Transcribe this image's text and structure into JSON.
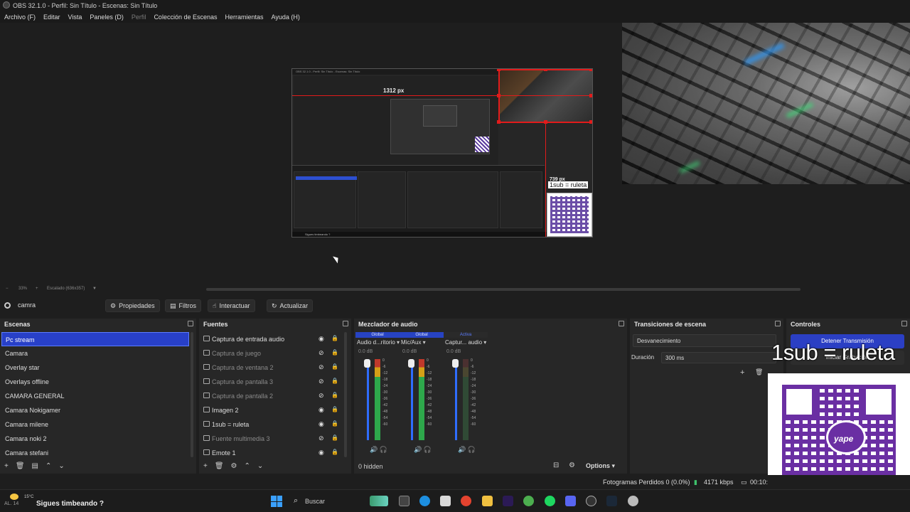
{
  "window": {
    "title": "OBS 32.1.0 - Perfil: Sin Título - Escenas: Sin Título"
  },
  "menu": [
    {
      "label": "Archivo (F)",
      "dim": false
    },
    {
      "label": "Editar",
      "dim": false
    },
    {
      "label": "Vista",
      "dim": false
    },
    {
      "label": "Paneles (D)",
      "dim": false
    },
    {
      "label": "Perfil",
      "dim": true
    },
    {
      "label": "Colección de Escenas",
      "dim": false
    },
    {
      "label": "Herramientas",
      "dim": false
    },
    {
      "label": "Ayuda (H)",
      "dim": false
    }
  ],
  "preview": {
    "px_label_top": "1312 px",
    "px_label_right": "739 px",
    "sub_label": "1sub = ruleta"
  },
  "zoom": {
    "value": "33%",
    "plus": "+",
    "minus": "−",
    "scene_size": "Escalado (636x357)"
  },
  "context": {
    "source_name": "camra",
    "properties": "Propiedades",
    "filters": "Filtros",
    "interact": "Interactuar",
    "refresh": "Actualizar"
  },
  "scenes": {
    "title": "Escenas",
    "items": [
      "Pc stream",
      "Camara",
      "Overlay star",
      "Overlays offline",
      "CAMARA GENERAL",
      "Camara Nokigamer",
      "Camara milene",
      "Camara noki 2",
      "Camara stefani"
    ],
    "active_index": 0
  },
  "sources": {
    "title": "Fuentes",
    "items": [
      {
        "label": "Captura de entrada audio",
        "visible": true,
        "icon": "microphone-icon"
      },
      {
        "label": "Captura de juego",
        "visible": false,
        "icon": "gamepad-icon"
      },
      {
        "label": "Captura de ventana 2",
        "visible": false,
        "icon": "window-icon"
      },
      {
        "label": "Captura de pantalla 3",
        "visible": false,
        "icon": "monitor-icon"
      },
      {
        "label": "Captura de pantalla 2",
        "visible": false,
        "icon": "monitor-icon"
      },
      {
        "label": "Imagen 2",
        "visible": true,
        "icon": "image-icon"
      },
      {
        "label": "1sub = ruleta",
        "visible": true,
        "icon": "text-icon"
      },
      {
        "label": "Fuente multimedia 3",
        "visible": false,
        "icon": "play-icon"
      },
      {
        "label": "Emote 1",
        "visible": true,
        "icon": "globe-icon"
      }
    ]
  },
  "mixer": {
    "title": "Mezclador de audio",
    "channels": [
      {
        "badge": "Global",
        "name": "Audio d...ritorio",
        "db": "0.0 dB",
        "muted": false,
        "active_badge": false
      },
      {
        "badge": "Global",
        "name": "Mic/Aux",
        "db": "0.0 dB",
        "muted": false,
        "active_badge": false
      },
      {
        "badge": "Activa",
        "name": "Captur... audio",
        "db": "0.0 dB",
        "muted": true,
        "active_badge": true
      }
    ],
    "scale": [
      "0",
      "-6",
      "-12",
      "-18",
      "-24",
      "-30",
      "-36",
      "-42",
      "-48",
      "-54",
      "-60"
    ],
    "hidden": "0 hidden",
    "options": "Options"
  },
  "transitions": {
    "title": "Transiciones de escena",
    "selected": "Desvanecimiento",
    "duration_label": "Duración",
    "duration_value": "300 ms"
  },
  "controls": {
    "title": "Controles",
    "stream_button": "Detener Transmisión",
    "record_button": "Iniciar Grabación"
  },
  "overlay": {
    "sub_text": "1sub = ruleta",
    "qr_logo": "yape"
  },
  "status": {
    "dropped": "Fotogramas Perdidos 0 (0.0%)",
    "bitrate": "4171 kbps",
    "time": "00:10:"
  },
  "taskbar": {
    "temp": "15°C",
    "weather_short": "AL. 14",
    "marquee": "Sigues timbeando ?",
    "search": "Buscar"
  },
  "colors": {
    "accent": "#2840c8",
    "record_red": "#e21b1b",
    "meter_green": "#2ea84b",
    "yape_purple": "#6a2fa3"
  }
}
